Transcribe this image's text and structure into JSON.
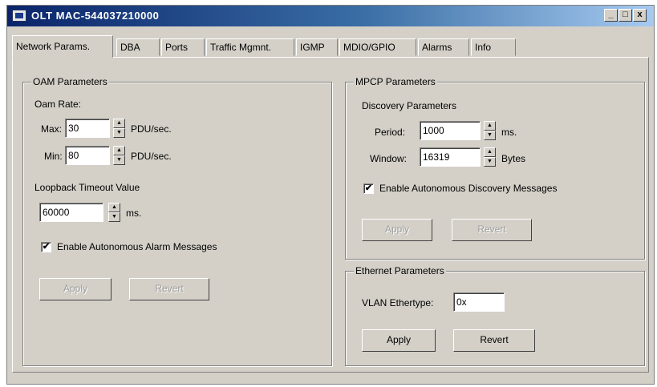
{
  "window": {
    "title": "OLT MAC-544037210000",
    "minimize": "_",
    "maximize": "□",
    "close": "x"
  },
  "tabs": [
    "Network Params.",
    "DBA",
    "Ports",
    "Traffic Mgmnt.",
    "IGMP",
    "MDIO/GPIO",
    "Alarms",
    "Info"
  ],
  "oam": {
    "title": "OAM Parameters",
    "rate_label": "Oam Rate:",
    "max_label": "Max:",
    "max_value": "30",
    "max_unit": "PDU/sec.",
    "min_label": "Min:",
    "min_value": "80",
    "min_unit": "PDU/sec.",
    "loopback_label": "Loopback Timeout Value",
    "loopback_value": "60000",
    "loopback_unit": "ms.",
    "alarm_label": "Enable Autonomous Alarm Messages",
    "alarm_checked": true,
    "apply": "Apply",
    "revert": "Revert"
  },
  "mpcp": {
    "title": "MPCP Parameters",
    "discovery_label": "Discovery Parameters",
    "period_label": "Period:",
    "period_value": "1000",
    "period_unit": "ms.",
    "window_label": "Window:",
    "window_value": "16319",
    "window_unit": "Bytes",
    "discovery_msg_label": "Enable Autonomous Discovery Messages",
    "discovery_checked": true,
    "apply": "Apply",
    "revert": "Revert"
  },
  "ethernet": {
    "title": "Ethernet Parameters",
    "vlan_label": "VLAN Ethertype:",
    "vlan_value": "0x",
    "apply": "Apply",
    "revert": "Revert"
  },
  "icons": {
    "check": "✔",
    "spin_up": "▲",
    "spin_down": "▼"
  }
}
